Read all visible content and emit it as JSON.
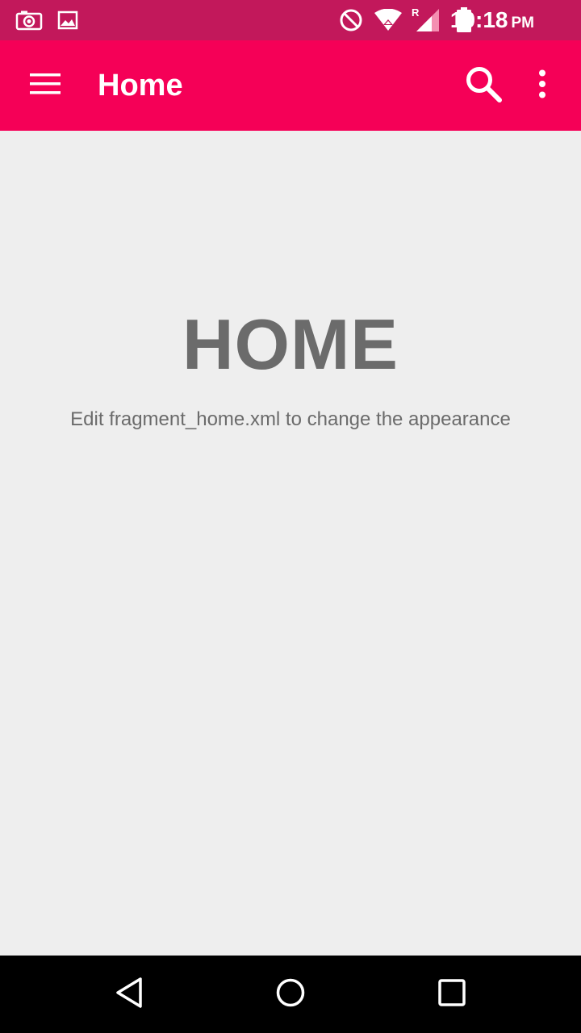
{
  "status_bar": {
    "time": "10:18",
    "ampm": "PM",
    "roaming": "R",
    "icons": [
      "camera-icon",
      "image-icon",
      "do-not-disturb-icon",
      "wifi-icon",
      "cellular-signal-icon",
      "battery-icon"
    ]
  },
  "app_bar": {
    "title": "Home",
    "icons": [
      "menu-icon",
      "search-icon",
      "more-vert-icon"
    ]
  },
  "main": {
    "heading": "HOME",
    "subtitle": "Edit fragment_home.xml to change the appearance"
  },
  "nav_bar": {
    "icons": [
      "back-icon",
      "home-icon",
      "recents-icon"
    ]
  },
  "colors": {
    "status_bar": "#c2185b",
    "app_bar": "#f50057",
    "background": "#eeeeee",
    "text": "#6b6b6b",
    "nav_bar": "#000000"
  }
}
